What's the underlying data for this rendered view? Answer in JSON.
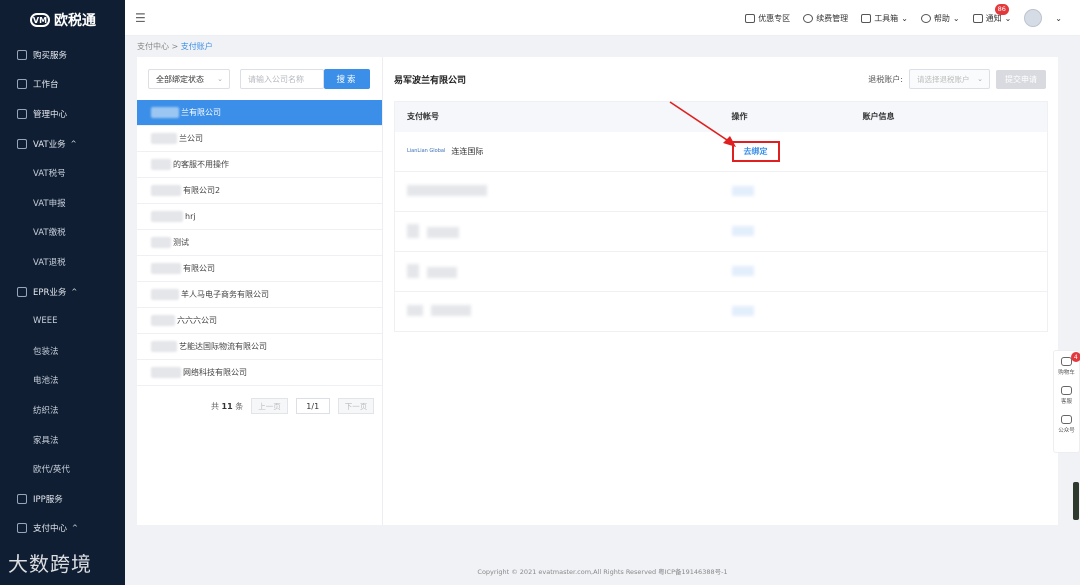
{
  "brand": {
    "name": "欧税通",
    "mark": "VM"
  },
  "sidebar": {
    "items": [
      {
        "label": "购买服务",
        "type": "group",
        "icon": "cart-icon"
      },
      {
        "label": "工作台",
        "type": "group",
        "icon": "desk-icon"
      },
      {
        "label": "管理中心",
        "type": "group",
        "icon": "manage-icon"
      },
      {
        "label": "VAT业务",
        "type": "group",
        "icon": "vat-icon",
        "caret": "^"
      },
      {
        "label": "VAT税号",
        "type": "sub"
      },
      {
        "label": "VAT申报",
        "type": "sub"
      },
      {
        "label": "VAT缴税",
        "type": "sub"
      },
      {
        "label": "VAT退税",
        "type": "sub"
      },
      {
        "label": "EPR业务",
        "type": "group",
        "icon": "epr-icon",
        "caret": "^"
      },
      {
        "label": "WEEE",
        "type": "sub"
      },
      {
        "label": "包装法",
        "type": "sub"
      },
      {
        "label": "电池法",
        "type": "sub"
      },
      {
        "label": "纺织法",
        "type": "sub"
      },
      {
        "label": "家具法",
        "type": "sub"
      },
      {
        "label": "欧代/英代",
        "type": "sub"
      },
      {
        "label": "IPP服务",
        "type": "group",
        "icon": "ipp-icon"
      },
      {
        "label": "支付中心",
        "type": "group",
        "icon": "pay-icon",
        "caret": "^"
      }
    ],
    "watermark": "大数跨境"
  },
  "topbar": {
    "items": [
      {
        "label": "优惠专区",
        "icon": "coupon-icon"
      },
      {
        "label": "续费管理",
        "icon": "renew-icon"
      },
      {
        "label": "工具箱",
        "icon": "toolbox-icon",
        "caret": "⌄"
      },
      {
        "label": "帮助",
        "icon": "help-icon",
        "caret": "⌄"
      },
      {
        "label": "通知",
        "icon": "bell-icon",
        "badge": "86",
        "caret": "⌄"
      }
    ]
  },
  "breadcrumb": {
    "parent": "支付中心",
    "sep": ">",
    "current": "支付账户"
  },
  "filter": {
    "status": "全部绑定状态",
    "search_placeholder": "请输入公司名称",
    "search_button": "搜索"
  },
  "companies": [
    {
      "label": "兰有限公司",
      "blur": 28,
      "active": true
    },
    {
      "label": "兰公司",
      "blur": 26
    },
    {
      "label": "的客服不用操作",
      "blur": 20
    },
    {
      "label": "有限公司2",
      "blur": 30
    },
    {
      "label": "hrj",
      "blur": 32
    },
    {
      "label": "测试",
      "blur": 20
    },
    {
      "label": "有限公司",
      "blur": 30
    },
    {
      "label": "羊人马电子商务有限公司",
      "blur": 28
    },
    {
      "label": "六六六公司",
      "blur": 24
    },
    {
      "label": "艺能达国际物流有限公司",
      "blur": 26
    },
    {
      "label": "网络科技有限公司",
      "blur": 30
    }
  ],
  "pager": {
    "total_prefix": "共",
    "total": "11",
    "total_suffix": "条",
    "prev": "上一页",
    "page": "1/1",
    "next": "下一页"
  },
  "detail": {
    "title": "易军波兰有限公司",
    "refund_label": "退税账户:",
    "refund_placeholder": "请选择退税账户",
    "submit": "提交申请",
    "columns": [
      "支付帐号",
      "操作",
      "账户信息"
    ],
    "first_row": {
      "brand": "LianLian Global",
      "account": "连连国际",
      "action": "去绑定"
    }
  },
  "floatbar": [
    {
      "label": "购物车",
      "icon": "cart-icon",
      "badge": "4"
    },
    {
      "label": "客服",
      "icon": "headset-icon"
    },
    {
      "label": "公众号",
      "icon": "wechat-icon"
    }
  ],
  "footer": "Copyright © 2021 evatmaster.com,All Rights Reserved 粤ICP备19146388号-1"
}
